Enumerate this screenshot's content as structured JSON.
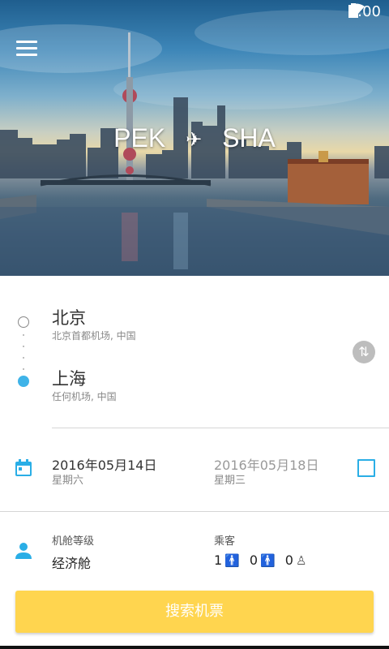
{
  "status_bar": {
    "time": "6:00",
    "wifi_icon": "wifi-icon",
    "battery_icon": "battery-icon"
  },
  "header": {
    "menu_icon": "hamburger-menu-icon",
    "origin_code": "PEK",
    "destination_code": "SHA",
    "plane_icon": "plane-icon"
  },
  "route": {
    "origin": {
      "city": "北京",
      "airport": "北京首都机场, 中国"
    },
    "destination": {
      "city": "上海",
      "airport": "任何机场, 中国"
    },
    "swap_icon": "swap-icon"
  },
  "dates": {
    "depart": {
      "date": "2016年05月14日",
      "weekday": "星期六"
    },
    "return": {
      "date": "2016年05月18日",
      "weekday": "星期三",
      "checked": false
    }
  },
  "cabin": {
    "label": "机舱等级",
    "value": "经济舱"
  },
  "passengers": {
    "label": "乘客",
    "adults": "1",
    "children": "0",
    "infants": "0"
  },
  "search_button": {
    "label": "搜索机票",
    "color": "#ffd54f"
  },
  "colors": {
    "accent": "#2aaee6",
    "dest_dot": "#3fb3e8"
  }
}
